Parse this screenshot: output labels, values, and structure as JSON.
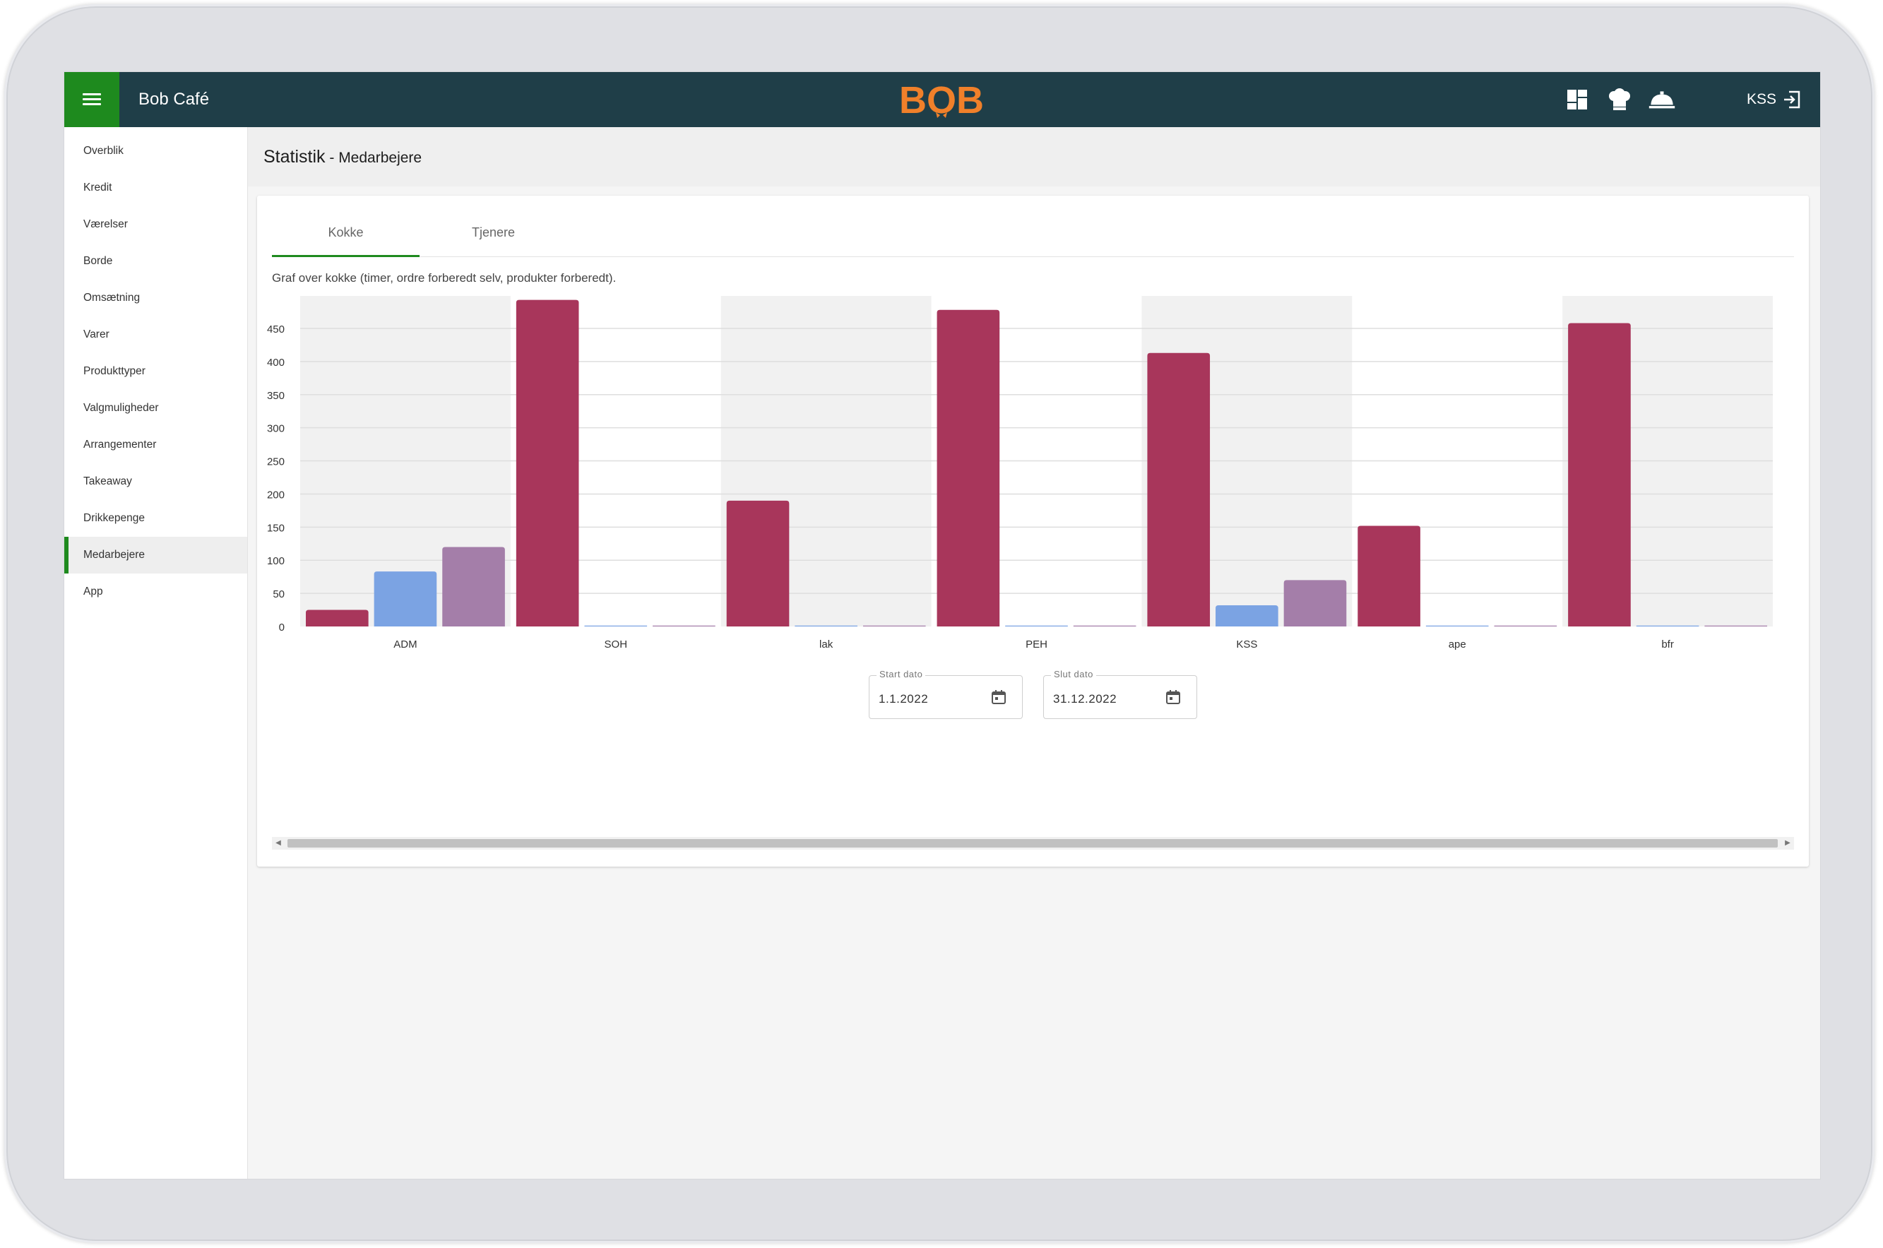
{
  "header": {
    "app_title": "Bob Café",
    "logo_text": "BOB",
    "user_label": "KSS"
  },
  "icons": {
    "menu": "hamburger-menu-icon",
    "dashboard": "dashboard-grid-icon",
    "chef": "chef-hat-icon",
    "service": "service-bell-icon",
    "logout": "logout-icon",
    "calendar": "calendar-icon"
  },
  "colors": {
    "topbar": "#1f3e48",
    "accent_green": "#1e8a1e",
    "logo_orange": "#f0802a",
    "series_hours": "#a8365b",
    "series_orders": "#7ba3e3",
    "series_products": "#a47ea9"
  },
  "sidebar": {
    "items": [
      {
        "label": "Overblik"
      },
      {
        "label": "Kredit"
      },
      {
        "label": "Værelser"
      },
      {
        "label": "Borde"
      },
      {
        "label": "Omsætning"
      },
      {
        "label": "Varer"
      },
      {
        "label": "Produkttyper"
      },
      {
        "label": "Valgmuligheder"
      },
      {
        "label": "Arrangementer"
      },
      {
        "label": "Takeaway"
      },
      {
        "label": "Drikkepenge"
      },
      {
        "label": "Medarbejere",
        "active": true
      },
      {
        "label": "App"
      }
    ]
  },
  "page": {
    "title": "Statistik",
    "subtitle": " - Medarbejere"
  },
  "tabs": [
    {
      "label": "Kokke",
      "active": true
    },
    {
      "label": "Tjenere",
      "active": false
    }
  ],
  "chart_description": "Graf over kokke (timer, ordre forberedt selv, produkter forberedt).",
  "chart_data": {
    "type": "bar",
    "categories": [
      "ADM",
      "SOH",
      "lak",
      "PEH",
      "KSS",
      "ape",
      "bfr"
    ],
    "series": [
      {
        "values": [
          25,
          493,
          190,
          478,
          413,
          152,
          458
        ]
      },
      {
        "values": [
          83,
          0,
          0,
          0,
          32,
          0,
          0
        ]
      },
      {
        "values": [
          120,
          0,
          0,
          0,
          70,
          0,
          0
        ]
      }
    ],
    "ylim": [
      0,
      450
    ],
    "yticks": [
      "0",
      "50",
      "100",
      "150",
      "200",
      "250",
      "300",
      "350",
      "400",
      "450"
    ],
    "grid": true,
    "legend": "none"
  },
  "dates": {
    "start_label": "Start dato",
    "start_value": "1.1.2022",
    "end_label": "Slut dato",
    "end_value": "31.12.2022"
  }
}
